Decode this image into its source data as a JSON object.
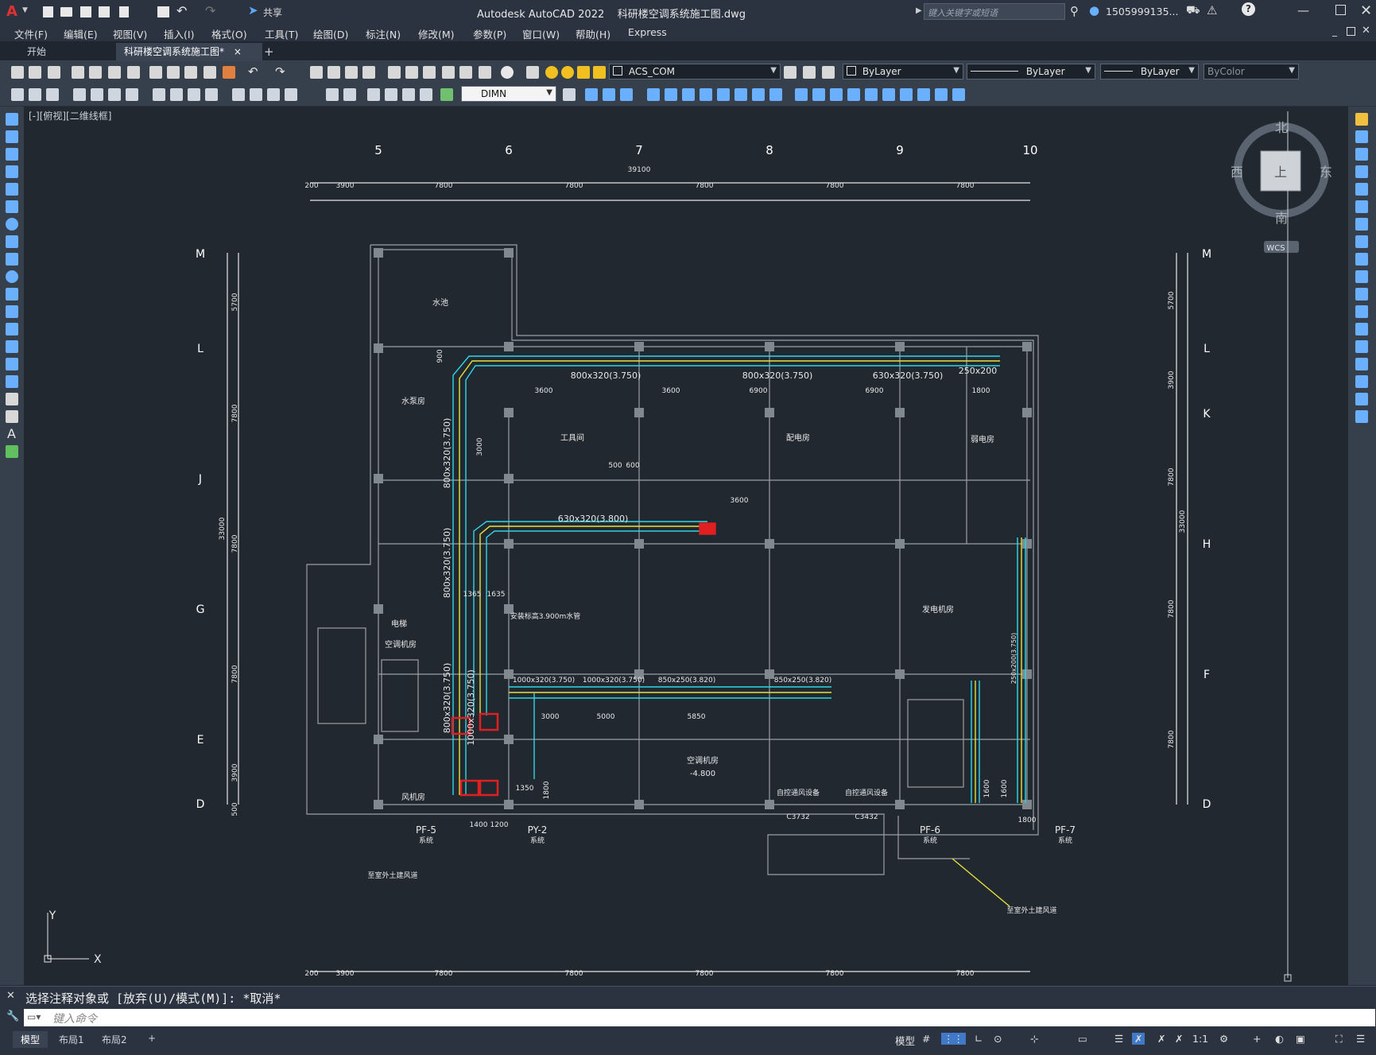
{
  "app": {
    "logo": "A",
    "title": "Autodesk AutoCAD 2022    科研楼空调系统施工图.dwg",
    "share_label": "共享",
    "search_placeholder": "键入关键字或短语",
    "user": "1505999135...",
    "help_icon": "question-icon"
  },
  "menu": [
    "文件(F)",
    "编辑(E)",
    "视图(V)",
    "插入(I)",
    "格式(O)",
    "工具(T)",
    "绘图(D)",
    "标注(N)",
    "修改(M)",
    "参数(P)",
    "窗口(W)",
    "帮助(H)",
    "Express"
  ],
  "tabs": {
    "start": "开始",
    "drawing": "科研楼空调系统施工图*",
    "add": "+",
    "close": "×"
  },
  "toolbar": {
    "layer": "ACS_COM",
    "color": "ByLayer",
    "linetype": "ByLayer",
    "lineweight": "ByLayer",
    "plotstyle": "ByColor",
    "dimstyle": "DIMN"
  },
  "viewport": {
    "label": "[-][俯视][二维线框]",
    "viewcube": {
      "north": "北",
      "south": "南",
      "east": "东",
      "west": "西",
      "top": "上",
      "wcs": "WCS"
    },
    "ucs": {
      "x": "X",
      "y": "Y"
    }
  },
  "drawing": {
    "col_axes": [
      "5",
      "6",
      "7",
      "8",
      "9",
      "10"
    ],
    "row_axes": [
      "M",
      "L",
      "K",
      "J",
      "H",
      "G",
      "F",
      "E",
      "D"
    ],
    "top_total_dim": "39100",
    "top_dims": [
      "200",
      "3900",
      "7800",
      "7800",
      "7800",
      "7800",
      "7800"
    ],
    "left_dims": [
      "5700",
      "7800",
      "7800",
      "7800",
      "3900",
      "500"
    ],
    "left_total": "33000",
    "right_dims": [
      "5700",
      "3900",
      "7800",
      "7800",
      "7800"
    ],
    "right_total": "33000",
    "rooms": [
      "水池",
      "水泵房",
      "工具间",
      "配电房",
      "弱电房",
      "发电机房",
      "空调机房",
      "风机房",
      "电梯",
      "空调机房"
    ],
    "room_level": "-4.800",
    "duct_labels": [
      "800x320(3.750)",
      "800x320(3.750)",
      "630x320(3.750)",
      "250x200",
      "630x320(3.800)",
      "1000x320(3.750)",
      "1000x320(3.750)",
      "850x250(3.820)",
      "850x250(3.820)",
      "800x320(3.750)",
      "800x320(3.750)",
      "800x320(3.750)",
      "1000x320(3.750)",
      "250x200(3.750)"
    ],
    "dims_inner": [
      "3600",
      "3600",
      "6900",
      "6900",
      "1800",
      "3000",
      "3600",
      "1365",
      "1635",
      "3000",
      "5000",
      "5850",
      "1350",
      "1800",
      "1400",
      "1200",
      "1600",
      "1600",
      "1800",
      "900",
      "500",
      "600"
    ],
    "equipment_tags": [
      "PF-5",
      "PY-2",
      "PF-6",
      "PF-7"
    ],
    "equipment_sub": [
      "系统",
      "系统",
      "系统",
      "系统"
    ],
    "notes": [
      "至室外土建风道",
      "至室外土建风道",
      "安装标高3.900m水管",
      "C3732",
      "C3432",
      "自控通风设备",
      "自控通风设备"
    ],
    "bottom_dims": [
      "200",
      "3900",
      "7800",
      "7800",
      "7800",
      "7800",
      "7800"
    ]
  },
  "command": {
    "history": "选择注释对象或 [放弃(U)/模式(M)]: *取消*",
    "input_placeholder": "键入命令"
  },
  "status": {
    "layouts": [
      "模型",
      "布局1",
      "布局2"
    ],
    "add": "+",
    "model": "模型",
    "scale": "1:1"
  },
  "colors": {
    "background": "#212830",
    "duct_cyan": "#2fd6e6",
    "duct_yellow": "#e8e23a",
    "accent_red": "#e02020",
    "wall": "#9aa0a6"
  }
}
